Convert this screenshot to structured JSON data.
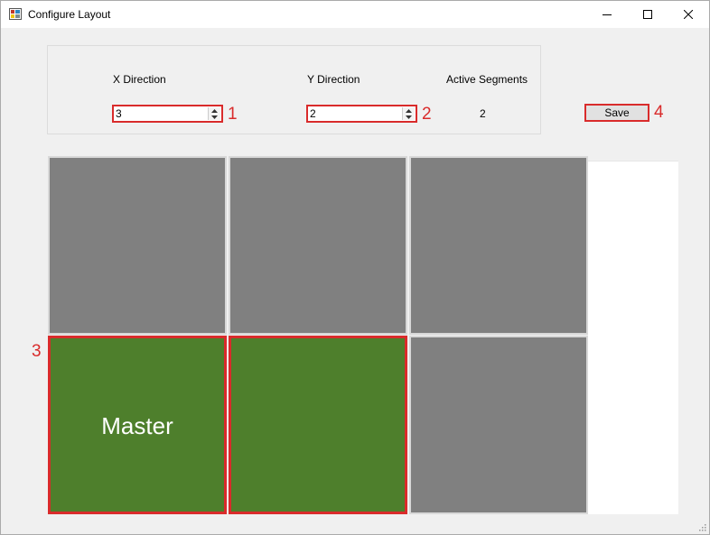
{
  "window": {
    "title": "Configure Layout",
    "icon": "app-layout-icon"
  },
  "settings": {
    "x_direction_label": "X Direction",
    "x_direction_value": "3",
    "y_direction_label": "Y Direction",
    "y_direction_value": "2",
    "active_segments_label": "Active Segments",
    "active_segments_value": "2"
  },
  "save": {
    "label": "Save"
  },
  "callouts": {
    "c1": "1",
    "c2": "2",
    "c3": "3",
    "c4": "4"
  },
  "grid": {
    "columns": 3,
    "rows": 2,
    "cells": [
      {
        "row": 0,
        "col": 0,
        "state": "inactive",
        "label": ""
      },
      {
        "row": 0,
        "col": 1,
        "state": "inactive",
        "label": ""
      },
      {
        "row": 0,
        "col": 2,
        "state": "inactive",
        "label": ""
      },
      {
        "row": 1,
        "col": 0,
        "state": "active",
        "label": "Master"
      },
      {
        "row": 1,
        "col": 1,
        "state": "active",
        "label": ""
      },
      {
        "row": 1,
        "col": 2,
        "state": "inactive",
        "label": ""
      }
    ]
  },
  "colors": {
    "active_cell": "#4e7f2c",
    "inactive_cell": "#808080",
    "highlight": "#d92b2b"
  }
}
